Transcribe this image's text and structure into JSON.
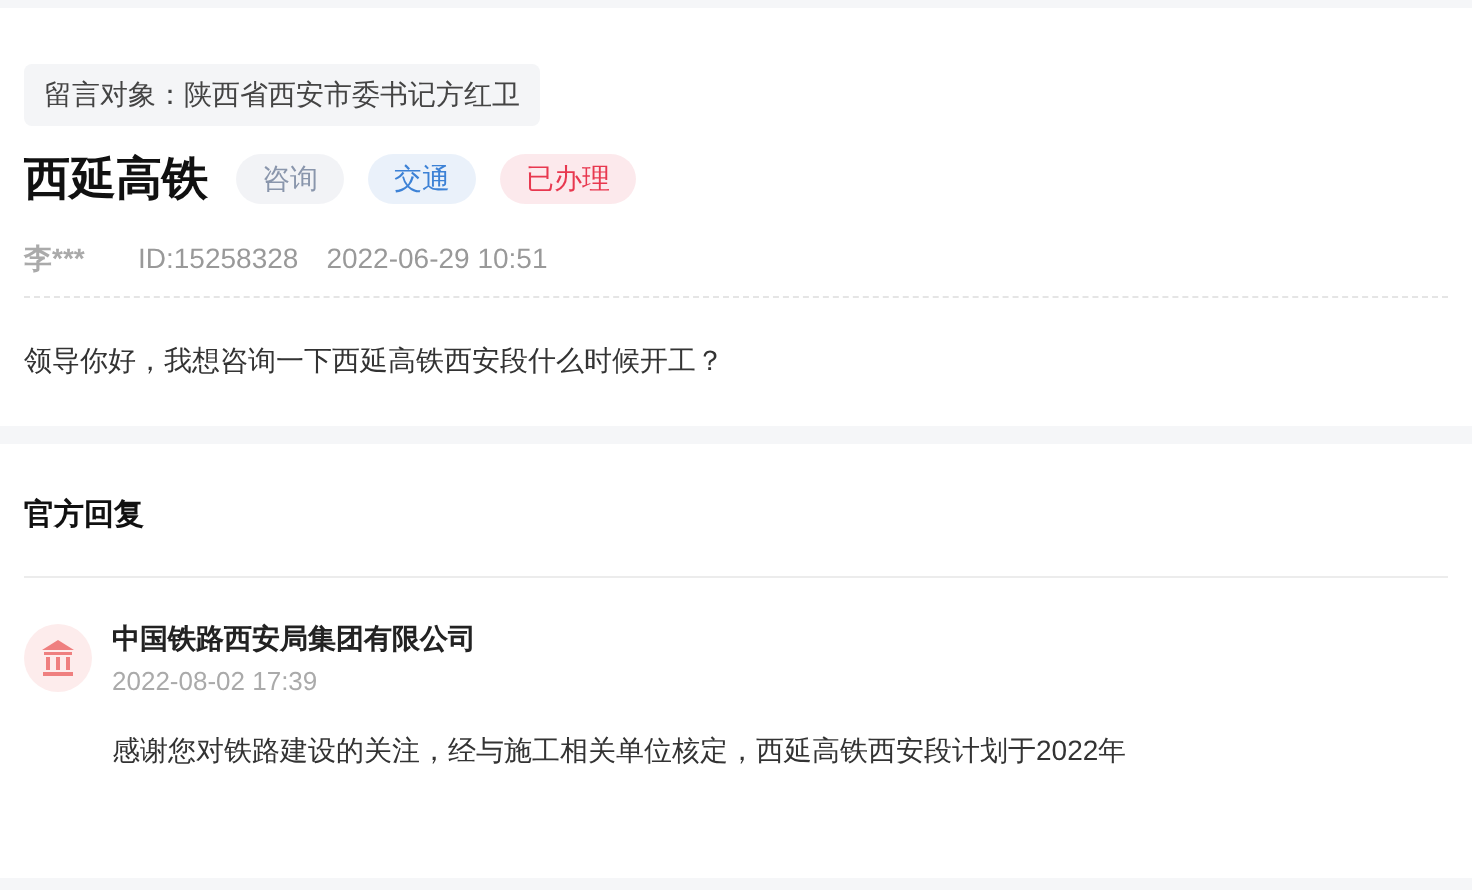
{
  "message": {
    "target": "留言对象：陕西省西安市委书记方红卫",
    "title": "西延高铁",
    "tags": [
      {
        "label": "咨询",
        "color": "#8a96ac"
      },
      {
        "label": "交通",
        "color": "#3d82d6"
      },
      {
        "label": "已办理",
        "color": "#e8384f"
      }
    ],
    "author": "李***",
    "id": "ID:15258328",
    "time": "2022-06-29 10:51",
    "content": "领导你好，我想咨询一下西延高铁西安段什么时候开工？"
  },
  "reply": {
    "heading": "官方回复",
    "org": "中国铁路西安局集团有限公司",
    "time": "2022-08-02 17:39",
    "content": "感谢您对铁路建设的关注，经与施工相关单位核定，西延高铁西安段计划于2022年"
  }
}
